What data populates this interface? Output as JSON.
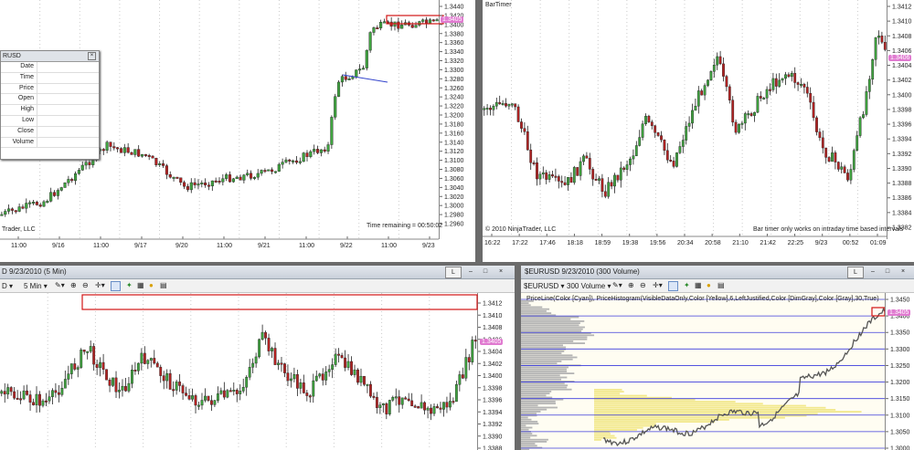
{
  "top_left": {
    "partial_title": "Trader, LLC",
    "time_remaining": "Time remaining = 00:50:02",
    "price_ticks": [
      "1.3440",
      "1.3420",
      "1.3400",
      "1.3380",
      "1.3360",
      "1.3340",
      "1.3320",
      "1.3300",
      "1.3280",
      "1.3260",
      "1.3240",
      "1.3220",
      "1.3200",
      "1.3180",
      "1.3160",
      "1.3140",
      "1.3120",
      "1.3100",
      "1.3080",
      "1.3060",
      "1.3040",
      "1.3020",
      "1.3000",
      "1.2980",
      "1.2960"
    ],
    "current_price": "1.3405",
    "time_ticks": [
      "11:00",
      "9/16",
      "11:00",
      "9/17",
      "9/20",
      "11:00",
      "9/21",
      "11:00",
      "9/22",
      "11:00",
      "9/23"
    ],
    "data_box": {
      "title": "RUSD",
      "rows": [
        "Date",
        "Time",
        "Price",
        "Open",
        "High",
        "Low",
        "Close",
        "Volume"
      ]
    }
  },
  "top_right": {
    "indicator_label": "BarTimer",
    "copyright": "© 2010 NinjaTrader, LLC",
    "message": "Bar timer only works on intraday time based intervals",
    "price_ticks": [
      "1.3412",
      "1.3410",
      "1.3408",
      "1.3406",
      "1.3404",
      "1.3402",
      "1.3400",
      "1.3398",
      "1.3396",
      "1.3394",
      "1.3392",
      "1.3390",
      "1.3388",
      "1.3386",
      "1.3384",
      "1.3382"
    ],
    "current_price": "1.3406",
    "time_ticks": [
      "16:22",
      "17:22",
      "17:46",
      "18:18",
      "18:59",
      "19:38",
      "19:56",
      "20:34",
      "20:58",
      "21:10",
      "21:42",
      "22:25",
      "9/23",
      "00:52",
      "01:09"
    ]
  },
  "bottom_left": {
    "title": "D  9/23/2010 (5 Min)",
    "instrument": "D",
    "interval": "5 Min",
    "window_buttons": [
      "L",
      "–",
      "□",
      "×"
    ],
    "price_ticks": [
      "1.3412",
      "1.3410",
      "1.3408",
      "1.3406",
      "1.3404",
      "1.3402",
      "1.3400",
      "1.3398",
      "1.3396",
      "1.3394",
      "1.3392",
      "1.3390",
      "1.3388"
    ],
    "current_price": "1.3405"
  },
  "bottom_right": {
    "title": "$EURUSD  9/23/2010 (300 Volume)",
    "instrument": "$EURUSD",
    "interval": "300 Volume",
    "window_buttons": [
      "L",
      "–",
      "□",
      "×"
    ],
    "indicator_text": "PriceLine(Color [Cyan]), PriceHistogram(VisibleDataOnly,Color [Yellow],6,LeftJustified,Color [DimGray],Color [Gray],30,True)",
    "price_ticks": [
      "1.3450",
      "1.3400",
      "1.3350",
      "1.3300",
      "1.3250",
      "1.3200",
      "1.3150",
      "1.3100",
      "1.3050",
      "1.3000"
    ],
    "current_price": "1.3405"
  },
  "colors": {
    "up": "#3fa33f",
    "down": "#b22222",
    "price_marker": "#e07ad0",
    "highlight_box": "#d11414"
  }
}
